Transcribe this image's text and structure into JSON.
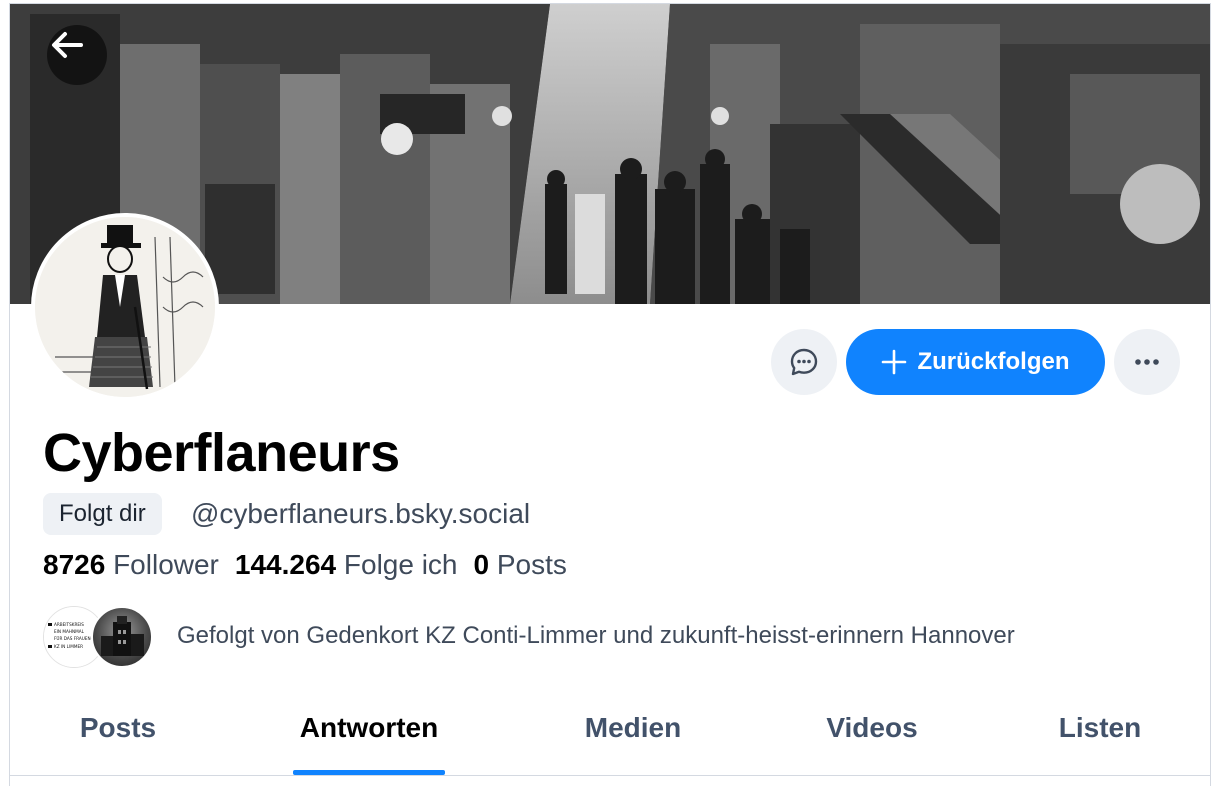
{
  "banner": {
    "alt": "Historic arcade street scene"
  },
  "profile": {
    "display_name": "Cyberflaneurs",
    "follows_you_badge": "Folgt dir",
    "handle": "@cyberflaneurs.bsky.social"
  },
  "actions": {
    "follow_back_label": "Zurückfolgen"
  },
  "stats": {
    "followers_count": "8726",
    "followers_label": "Follower",
    "following_count": "144.264",
    "following_label": "Folge ich",
    "posts_count": "0",
    "posts_label": "Posts"
  },
  "followed_by": {
    "text": "Gefolgt von Gedenkort KZ Conti-Limmer und zukunft-heisst-erinnern Hannover",
    "avatar1_lines": [
      "ARBEITSKREIS",
      "EIN MAHNMAL",
      "FÜR DAS FRAUEN-",
      "KZ IN LIMMER"
    ]
  },
  "tabs": [
    {
      "label": "Posts",
      "active": false
    },
    {
      "label": "Antworten",
      "active": true
    },
    {
      "label": "Medien",
      "active": false
    },
    {
      "label": "Videos",
      "active": false
    },
    {
      "label": "Listen",
      "active": false
    }
  ],
  "colors": {
    "accent": "#1083fe",
    "muted_text": "#3f4a5a",
    "button_bg": "#eef1f5"
  }
}
